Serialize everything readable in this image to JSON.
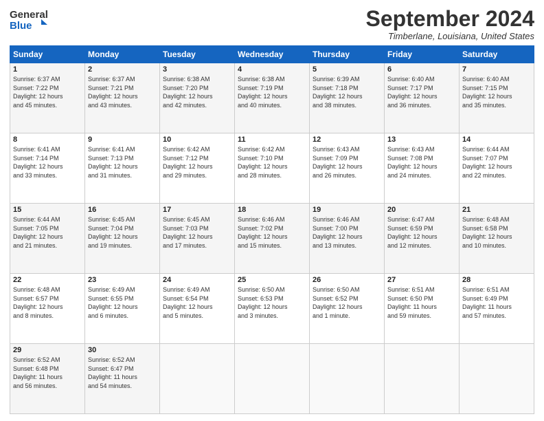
{
  "header": {
    "logo_line1": "General",
    "logo_line2": "Blue",
    "month_title": "September 2024",
    "location": "Timberlane, Louisiana, United States"
  },
  "days_of_week": [
    "Sunday",
    "Monday",
    "Tuesday",
    "Wednesday",
    "Thursday",
    "Friday",
    "Saturday"
  ],
  "weeks": [
    [
      {
        "day": "1",
        "info": "Sunrise: 6:37 AM\nSunset: 7:22 PM\nDaylight: 12 hours\nand 45 minutes."
      },
      {
        "day": "2",
        "info": "Sunrise: 6:37 AM\nSunset: 7:21 PM\nDaylight: 12 hours\nand 43 minutes."
      },
      {
        "day": "3",
        "info": "Sunrise: 6:38 AM\nSunset: 7:20 PM\nDaylight: 12 hours\nand 42 minutes."
      },
      {
        "day": "4",
        "info": "Sunrise: 6:38 AM\nSunset: 7:19 PM\nDaylight: 12 hours\nand 40 minutes."
      },
      {
        "day": "5",
        "info": "Sunrise: 6:39 AM\nSunset: 7:18 PM\nDaylight: 12 hours\nand 38 minutes."
      },
      {
        "day": "6",
        "info": "Sunrise: 6:40 AM\nSunset: 7:17 PM\nDaylight: 12 hours\nand 36 minutes."
      },
      {
        "day": "7",
        "info": "Sunrise: 6:40 AM\nSunset: 7:15 PM\nDaylight: 12 hours\nand 35 minutes."
      }
    ],
    [
      {
        "day": "8",
        "info": "Sunrise: 6:41 AM\nSunset: 7:14 PM\nDaylight: 12 hours\nand 33 minutes."
      },
      {
        "day": "9",
        "info": "Sunrise: 6:41 AM\nSunset: 7:13 PM\nDaylight: 12 hours\nand 31 minutes."
      },
      {
        "day": "10",
        "info": "Sunrise: 6:42 AM\nSunset: 7:12 PM\nDaylight: 12 hours\nand 29 minutes."
      },
      {
        "day": "11",
        "info": "Sunrise: 6:42 AM\nSunset: 7:10 PM\nDaylight: 12 hours\nand 28 minutes."
      },
      {
        "day": "12",
        "info": "Sunrise: 6:43 AM\nSunset: 7:09 PM\nDaylight: 12 hours\nand 26 minutes."
      },
      {
        "day": "13",
        "info": "Sunrise: 6:43 AM\nSunset: 7:08 PM\nDaylight: 12 hours\nand 24 minutes."
      },
      {
        "day": "14",
        "info": "Sunrise: 6:44 AM\nSunset: 7:07 PM\nDaylight: 12 hours\nand 22 minutes."
      }
    ],
    [
      {
        "day": "15",
        "info": "Sunrise: 6:44 AM\nSunset: 7:05 PM\nDaylight: 12 hours\nand 21 minutes."
      },
      {
        "day": "16",
        "info": "Sunrise: 6:45 AM\nSunset: 7:04 PM\nDaylight: 12 hours\nand 19 minutes."
      },
      {
        "day": "17",
        "info": "Sunrise: 6:45 AM\nSunset: 7:03 PM\nDaylight: 12 hours\nand 17 minutes."
      },
      {
        "day": "18",
        "info": "Sunrise: 6:46 AM\nSunset: 7:02 PM\nDaylight: 12 hours\nand 15 minutes."
      },
      {
        "day": "19",
        "info": "Sunrise: 6:46 AM\nSunset: 7:00 PM\nDaylight: 12 hours\nand 13 minutes."
      },
      {
        "day": "20",
        "info": "Sunrise: 6:47 AM\nSunset: 6:59 PM\nDaylight: 12 hours\nand 12 minutes."
      },
      {
        "day": "21",
        "info": "Sunrise: 6:48 AM\nSunset: 6:58 PM\nDaylight: 12 hours\nand 10 minutes."
      }
    ],
    [
      {
        "day": "22",
        "info": "Sunrise: 6:48 AM\nSunset: 6:57 PM\nDaylight: 12 hours\nand 8 minutes."
      },
      {
        "day": "23",
        "info": "Sunrise: 6:49 AM\nSunset: 6:55 PM\nDaylight: 12 hours\nand 6 minutes."
      },
      {
        "day": "24",
        "info": "Sunrise: 6:49 AM\nSunset: 6:54 PM\nDaylight: 12 hours\nand 5 minutes."
      },
      {
        "day": "25",
        "info": "Sunrise: 6:50 AM\nSunset: 6:53 PM\nDaylight: 12 hours\nand 3 minutes."
      },
      {
        "day": "26",
        "info": "Sunrise: 6:50 AM\nSunset: 6:52 PM\nDaylight: 12 hours\nand 1 minute."
      },
      {
        "day": "27",
        "info": "Sunrise: 6:51 AM\nSunset: 6:50 PM\nDaylight: 11 hours\nand 59 minutes."
      },
      {
        "day": "28",
        "info": "Sunrise: 6:51 AM\nSunset: 6:49 PM\nDaylight: 11 hours\nand 57 minutes."
      }
    ],
    [
      {
        "day": "29",
        "info": "Sunrise: 6:52 AM\nSunset: 6:48 PM\nDaylight: 11 hours\nand 56 minutes."
      },
      {
        "day": "30",
        "info": "Sunrise: 6:52 AM\nSunset: 6:47 PM\nDaylight: 11 hours\nand 54 minutes."
      },
      {
        "day": "",
        "info": ""
      },
      {
        "day": "",
        "info": ""
      },
      {
        "day": "",
        "info": ""
      },
      {
        "day": "",
        "info": ""
      },
      {
        "day": "",
        "info": ""
      }
    ]
  ]
}
